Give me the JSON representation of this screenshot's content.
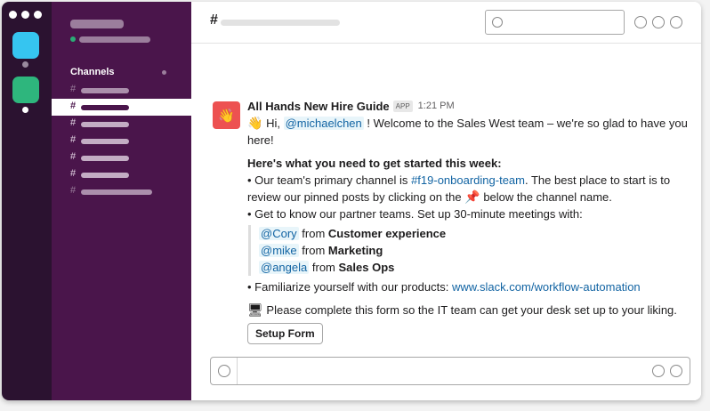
{
  "sidebar": {
    "channels_title": "Channels",
    "hash": "#"
  },
  "header": {
    "hash": "#"
  },
  "message": {
    "sender": "All Hands New Hire Guide",
    "badge": "APP",
    "time": "1:21 PM",
    "greeting_hi": "Hi,",
    "mention_user": "@michaelchen",
    "greeting_rest": "! Welcome to the Sales West team – we're so glad to have you here!",
    "heading": "Here's what you need to get started this week:",
    "b1_pre": "• Our team's primary channel is",
    "b1_channel": "#f19-onboarding-team",
    "b1_post": ". The best place to start is to review our pinned posts by clicking on the",
    "b1_post2": "below the channel name.",
    "b2": "• Get to know our partner teams. Set up 30-minute meetings with:",
    "contacts": [
      {
        "mention": "@Cory",
        "from": "from",
        "team": "Customer experience"
      },
      {
        "mention": "@mike",
        "from": "from",
        "team": "Marketing"
      },
      {
        "mention": "@angela",
        "from": "from",
        "team": "Sales Ops"
      }
    ],
    "b3_pre": "• Familiarize yourself with our products:",
    "b3_link": "www.slack.com/workflow-automation",
    "form_text": "Please complete this form so the IT team can get your desk set up to your liking.",
    "button_label": "Setup Form"
  },
  "icons": {
    "avatar": "waving-hand",
    "wave": "waving-hand",
    "pin": "pushpin",
    "computer": "desktop-computer"
  },
  "colors": {
    "sidebar": "#4a154b",
    "rail": "#2b1230",
    "link": "#1264a3",
    "avatar_bg": "#ed5151",
    "ws1": "#36c5f0",
    "ws2": "#2eb67d"
  }
}
